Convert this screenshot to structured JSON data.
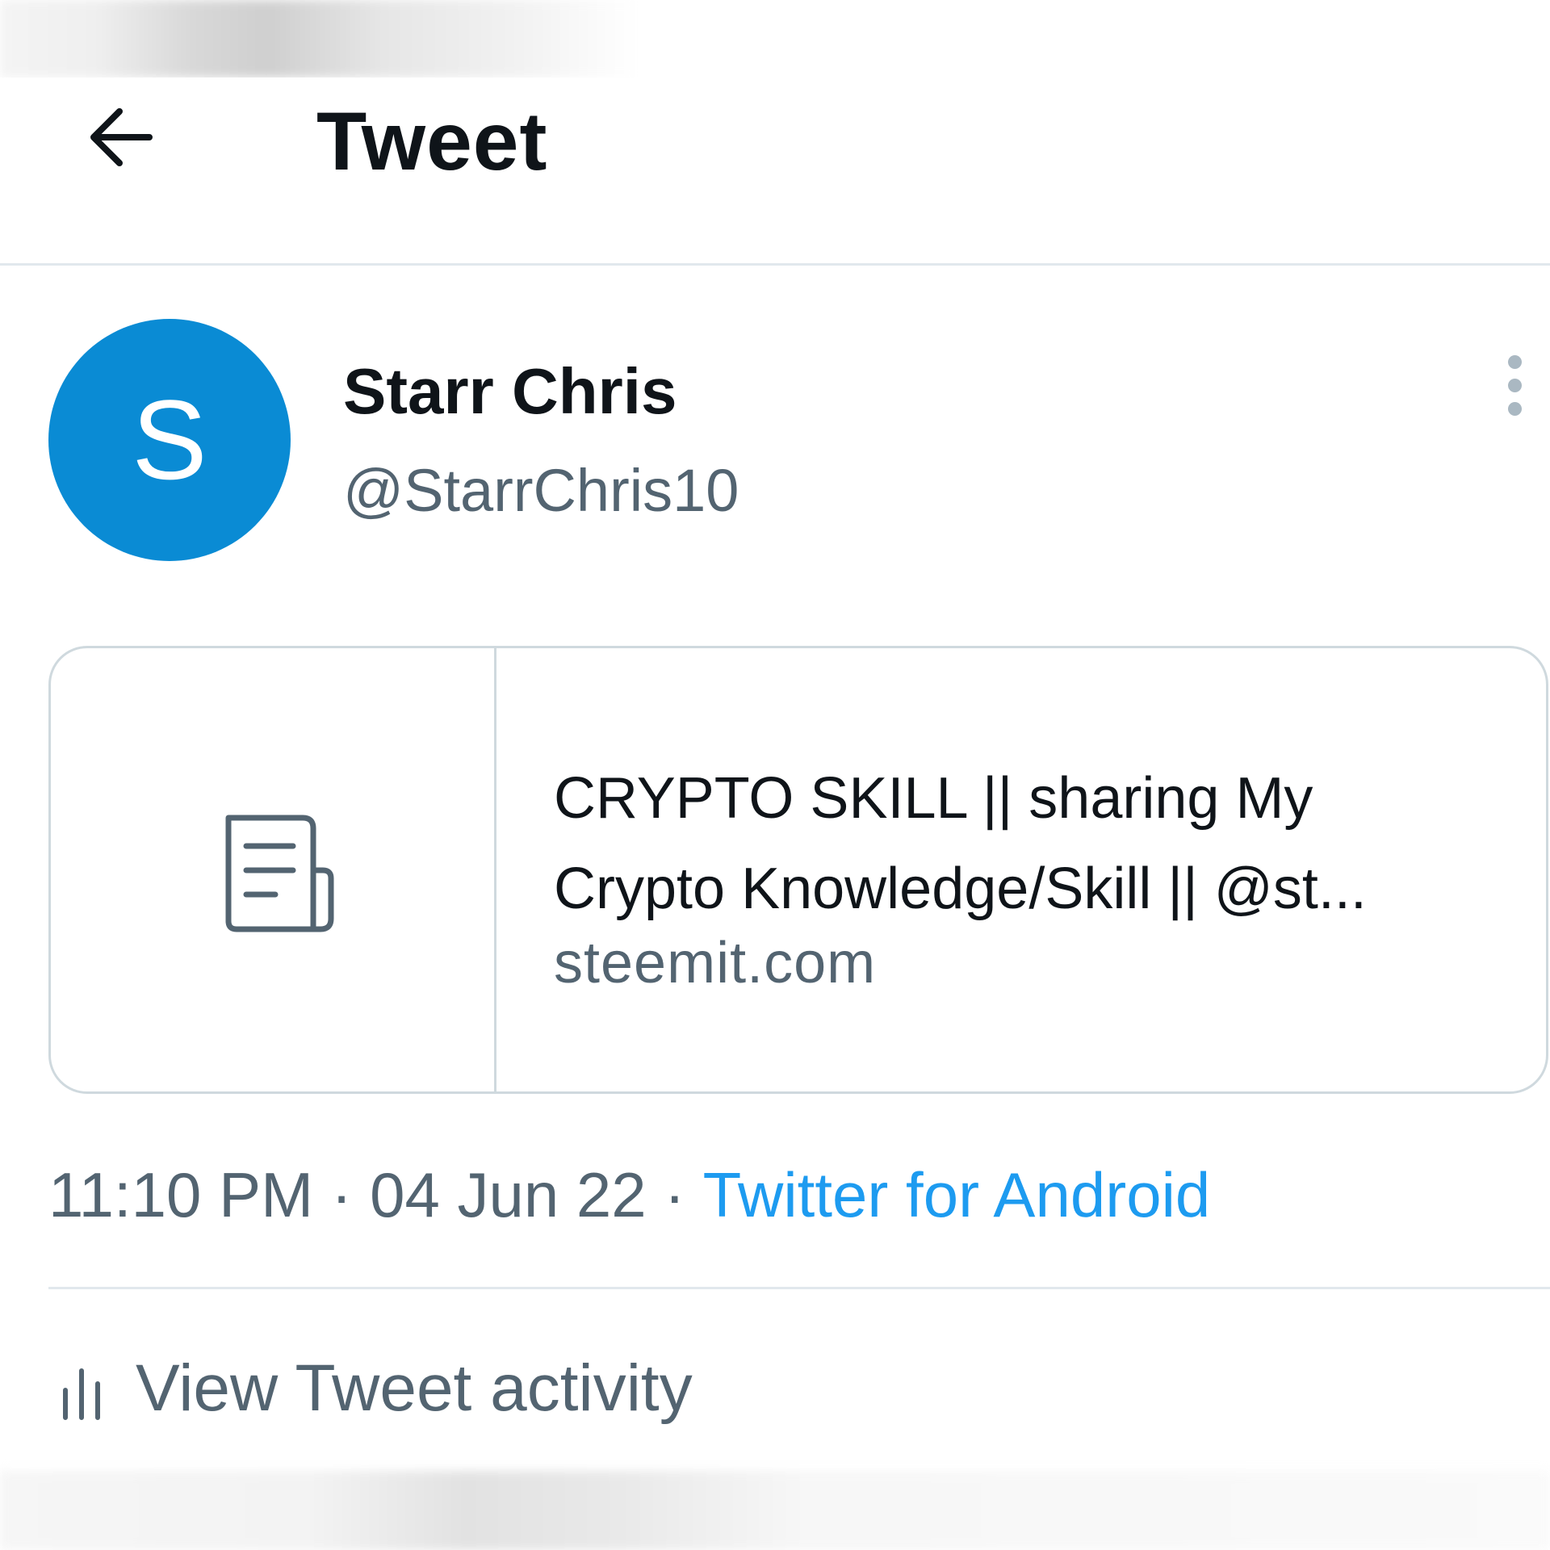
{
  "header": {
    "title": "Tweet",
    "back_icon": "arrow-left-icon"
  },
  "tweet": {
    "avatar_letter": "S",
    "avatar_color": "#0a8bd4",
    "display_name": "Starr Chris",
    "handle": "@StarrChris10",
    "more_icon": "more-vertical-icon"
  },
  "link_card": {
    "icon": "article-icon",
    "title_line1": "CRYPTO SKILL || sharing My",
    "title_line2": "Crypto Knowledge/Skill || @st...",
    "domain": "steemit.com"
  },
  "meta": {
    "time": "11:10 PM",
    "separator": "·",
    "date": "04 Jun 22",
    "source": "Twitter for Android",
    "source_color": "#1d9bf0"
  },
  "activity": {
    "icon": "bar-chart-icon",
    "label": "View Tweet activity"
  }
}
